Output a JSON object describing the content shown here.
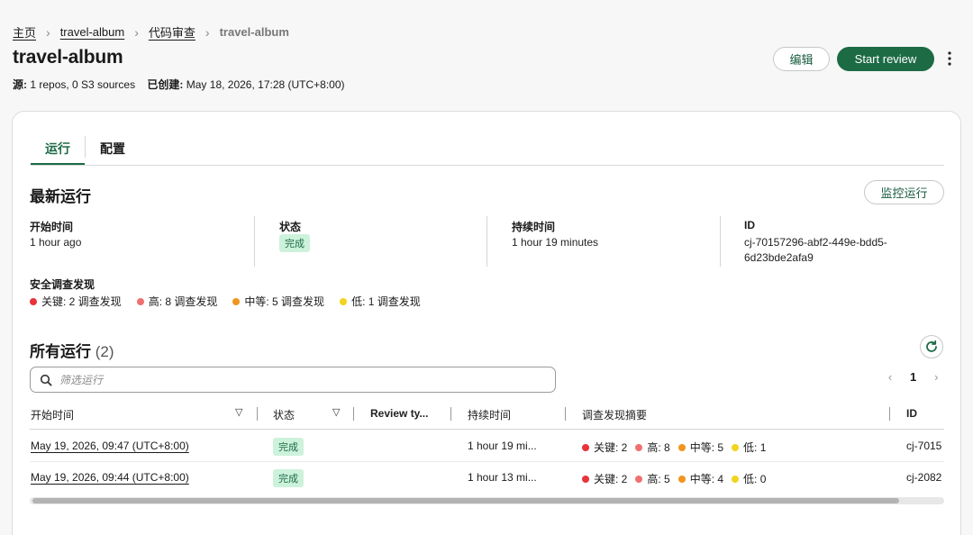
{
  "breadcrumb": {
    "home": "主页",
    "album": "travel-album",
    "code_review": "代码审查",
    "current": "travel-album"
  },
  "header": {
    "title": "travel-album",
    "source_label": "源:",
    "source_value": "1 repos, 0 S3 sources",
    "created_label": "已创建:",
    "created_value": "May 18, 2026, 17:28 (UTC+8:00)",
    "edit_label": "编辑",
    "start_review_label": "Start review"
  },
  "tabs": [
    {
      "label": "运行"
    },
    {
      "label": "配置"
    }
  ],
  "latest_run": {
    "title": "最新运行",
    "monitor_label": "监控运行",
    "start_time_label": "开始时间",
    "start_time_value": "1 hour ago",
    "status_label": "状态",
    "status_value": "完成",
    "duration_label": "持续时间",
    "duration_value": "1 hour 19 minutes",
    "id_label": "ID",
    "id_line1": "cj-70157296-abf2-449e-bdd5-",
    "id_line2": "6d23bde2afa9",
    "findings_label": "安全调查发现",
    "findings": [
      {
        "text": "关键: 2 调查发现"
      },
      {
        "text": "高: 8 调查发现"
      },
      {
        "text": "中等: 5 调查发现"
      },
      {
        "text": "低: 1 调查发现"
      }
    ]
  },
  "all_runs": {
    "title": "所有运行",
    "count": "(2)",
    "search_placeholder": "筛选运行",
    "page": "1",
    "columns": {
      "start_time": "开始时间",
      "status": "状态",
      "review_type": "Review ty...",
      "duration": "持续时间",
      "summary": "调查发现摘要",
      "id": "ID"
    },
    "rows": [
      {
        "start_time": "May 19, 2026, 09:47 (UTC+8:00)",
        "status": "完成",
        "duration": "1 hour 19 mi...",
        "critical": "关键: 2",
        "high": "高: 8",
        "medium": "中等: 5",
        "low": "低: 1",
        "id": "cj-7015"
      },
      {
        "start_time": "May 19, 2026, 09:44 (UTC+8:00)",
        "status": "完成",
        "duration": "1 hour 13 mi...",
        "critical": "关键: 2",
        "high": "高: 5",
        "medium": "中等: 4",
        "low": "低: 0",
        "id": "cj-2082"
      }
    ]
  },
  "colors": {
    "brand_green": "#1d6b45",
    "badge_bg": "#cdf2dc",
    "critical": "#e8333a",
    "high": "#f07070",
    "medium": "#f0951e",
    "low": "#f2d41f"
  },
  "icons": [
    "chevron-right-icon",
    "more-vertical-icon",
    "refresh-icon",
    "search-icon",
    "sort-down-icon",
    "chevron-left-icon"
  ]
}
